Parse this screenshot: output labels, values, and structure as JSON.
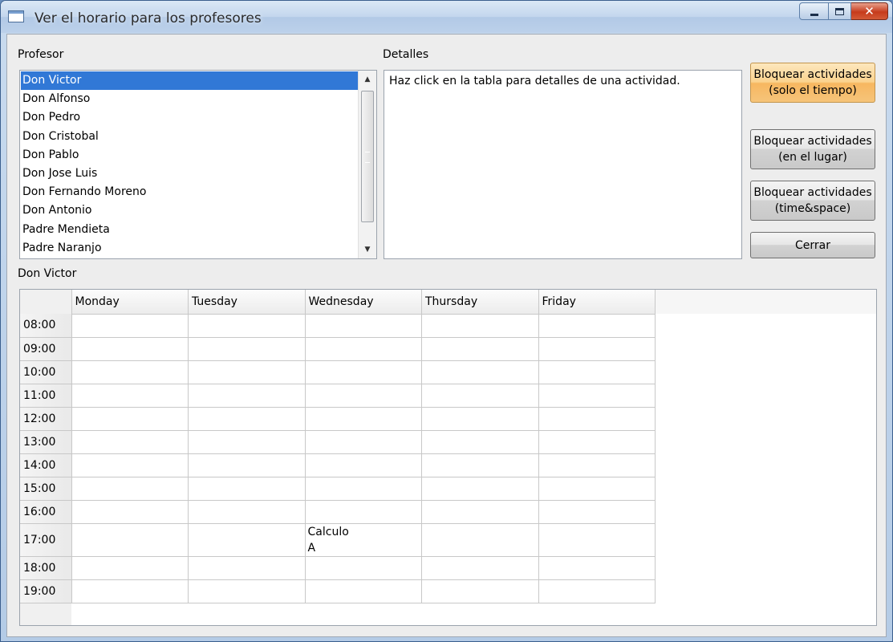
{
  "window": {
    "title": "Ver el horario para los profesores",
    "controls": {
      "minimize": "minimize-icon",
      "maximize": "maximize-icon",
      "close": "✕"
    }
  },
  "professor_panel": {
    "label": "Profesor",
    "items": [
      "Don Victor",
      "Don Alfonso",
      "Don Pedro",
      "Don Cristobal",
      "Don Pablo",
      "Don Jose Luis",
      "Don Fernando Moreno",
      "Don Antonio",
      "Padre Mendieta",
      "Padre Naranjo"
    ],
    "selected_index": 0
  },
  "details_panel": {
    "label": "Detalles",
    "text": "Haz click en la tabla para detalles de una actividad."
  },
  "buttons": {
    "lock_time": {
      "line1": "Bloquear actividades",
      "line2": "(solo el tiempo)"
    },
    "lock_space": {
      "line1": "Bloquear actividades",
      "line2": "(en el lugar)"
    },
    "lock_timespace": {
      "line1": "Bloquear actividades",
      "line2": "(time&space)"
    },
    "close": {
      "label": "Cerrar"
    }
  },
  "schedule": {
    "teacher_label": "Don Victor",
    "days": [
      "Monday",
      "Tuesday",
      "Wednesday",
      "Thursday",
      "Friday"
    ],
    "times": [
      "08:00",
      "09:00",
      "10:00",
      "11:00",
      "12:00",
      "13:00",
      "14:00",
      "15:00",
      "16:00",
      "17:00",
      "18:00",
      "19:00"
    ],
    "activities": [
      {
        "day_index": 2,
        "time_index": 9,
        "subject": "Calculo",
        "group": "A"
      }
    ]
  },
  "colors": {
    "selection": "#3178d6",
    "hot_button": "#f7b760"
  }
}
